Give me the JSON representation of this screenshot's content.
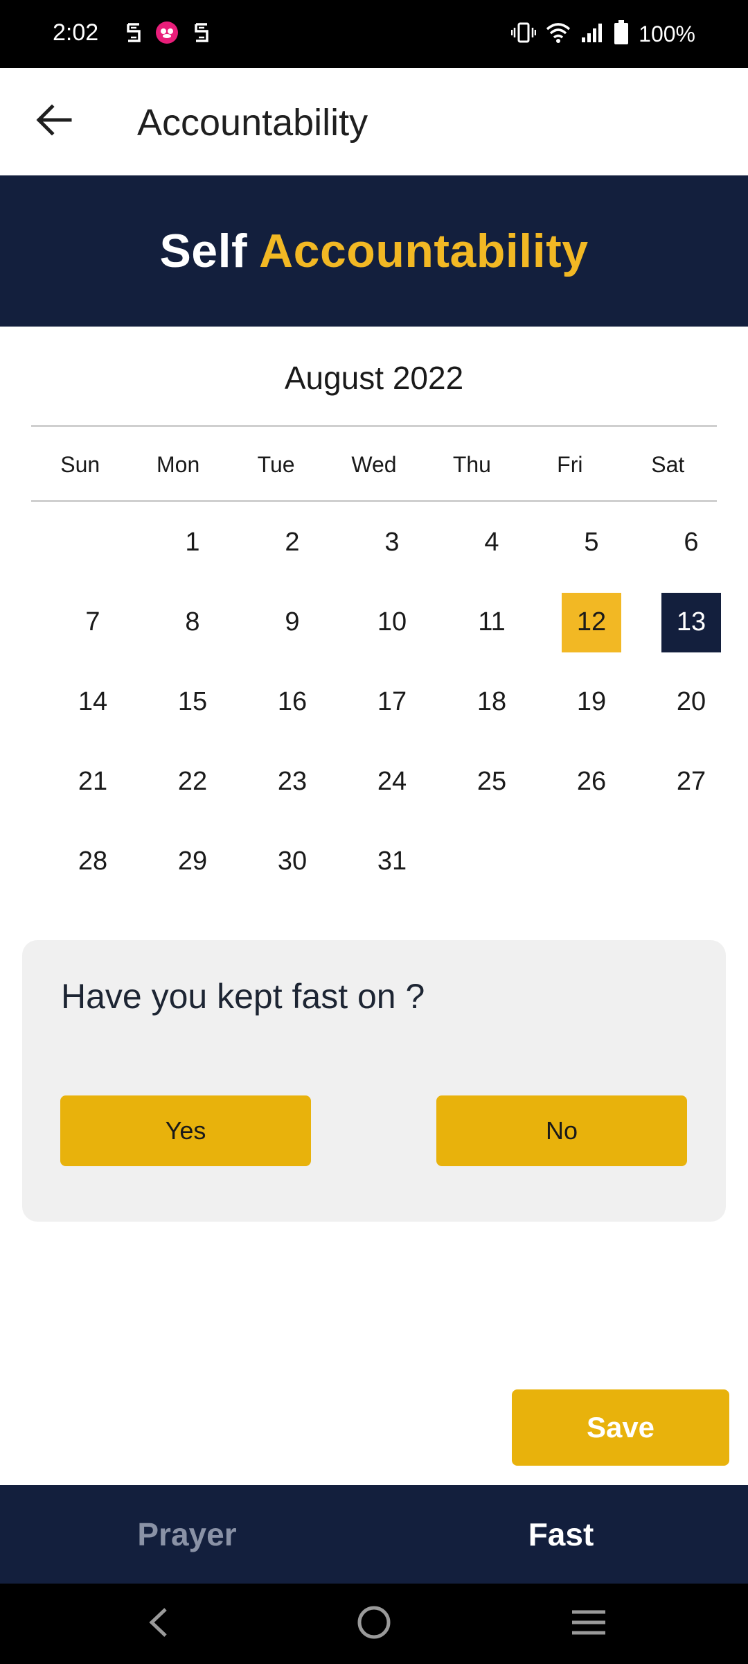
{
  "status_bar": {
    "time": "2:02",
    "battery_text": "100%",
    "notification_icons": [
      "s-logo-icon",
      "pink-app-icon",
      "s-logo-icon"
    ],
    "system_icons": [
      "vibrate-icon",
      "wifi-icon",
      "signal-icon",
      "battery-icon"
    ]
  },
  "app_bar": {
    "title": "Accountability",
    "back_icon": "arrow-back-icon"
  },
  "banner": {
    "word1": "Self",
    "word2": "Accountability"
  },
  "calendar": {
    "month_label": "August 2022",
    "weekdays": [
      "Sun",
      "Mon",
      "Tue",
      "Wed",
      "Thu",
      "Fri",
      "Sat"
    ],
    "first_weekday_index": 1,
    "days": [
      "1",
      "2",
      "3",
      "4",
      "5",
      "6",
      "7",
      "8",
      "9",
      "10",
      "11",
      "12",
      "13",
      "14",
      "15",
      "16",
      "17",
      "18",
      "19",
      "20",
      "21",
      "22",
      "23",
      "24",
      "25",
      "26",
      "27",
      "28",
      "29",
      "30",
      "31"
    ],
    "selected_day": "12",
    "today_day": "13"
  },
  "question": {
    "text": "Have you kept fast on  ?",
    "yes_label": "Yes",
    "no_label": "No"
  },
  "save_label": "Save",
  "tabs": [
    {
      "label": "Prayer",
      "active": false
    },
    {
      "label": "Fast",
      "active": true
    }
  ],
  "nav_bar": {
    "icons": [
      "nav-back-icon",
      "nav-home-icon",
      "nav-recents-icon"
    ]
  },
  "colors": {
    "navy": "#131f3d",
    "gold": "#f2b824",
    "button_gold": "#e8b20c",
    "card_bg": "#f0f0f0"
  }
}
